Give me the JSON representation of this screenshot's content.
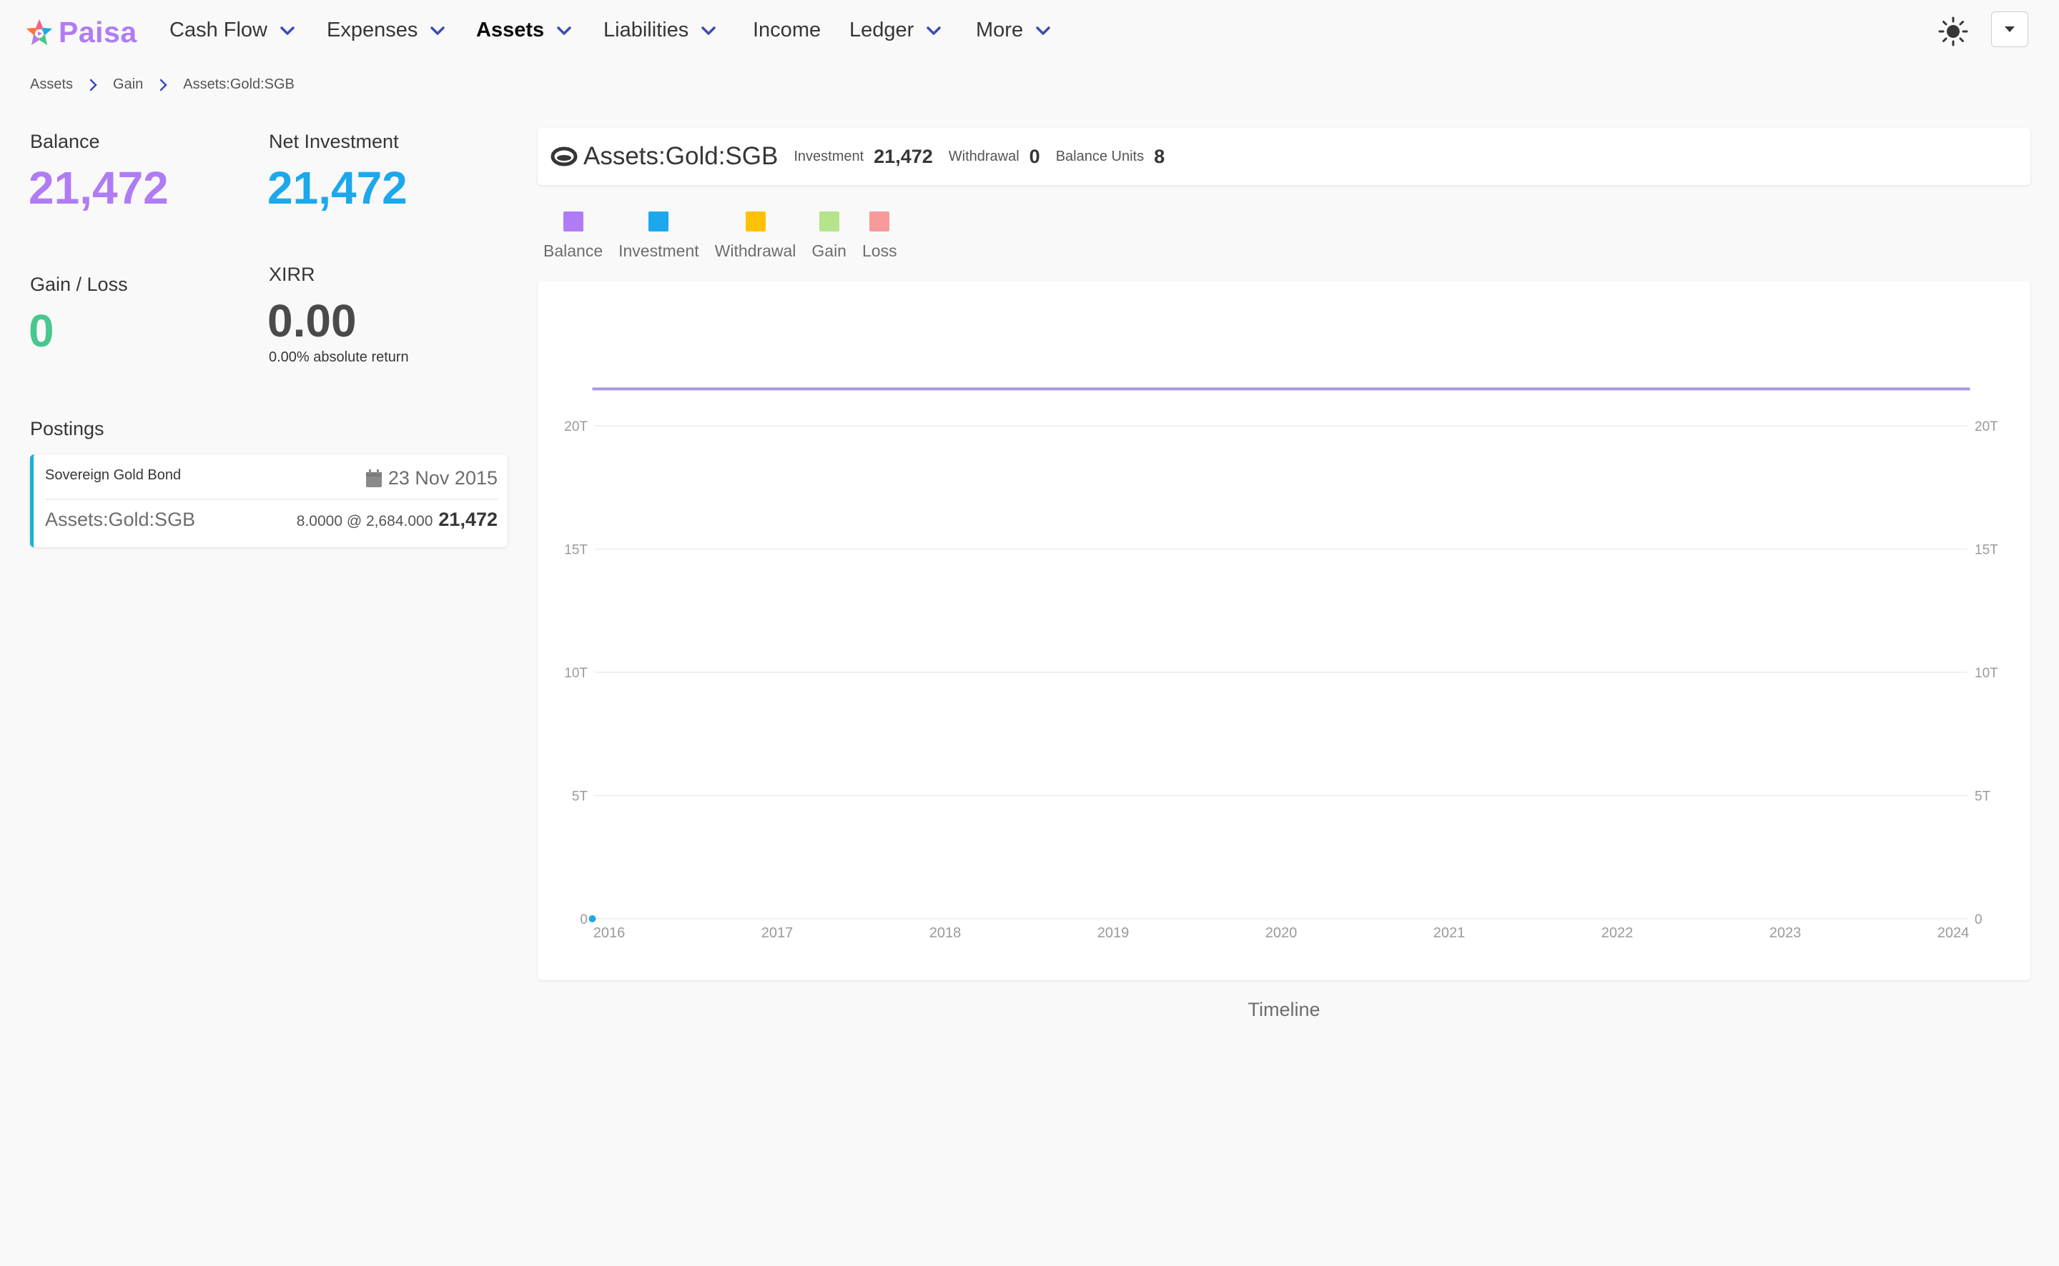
{
  "app": {
    "name": "Paisa"
  },
  "nav": {
    "items": [
      {
        "label": "Cash Flow",
        "has_dropdown": true,
        "active": false
      },
      {
        "label": "Expenses",
        "has_dropdown": true,
        "active": false
      },
      {
        "label": "Assets",
        "has_dropdown": true,
        "active": true
      },
      {
        "label": "Liabilities",
        "has_dropdown": true,
        "active": false
      },
      {
        "label": "Income",
        "has_dropdown": false,
        "active": false
      },
      {
        "label": "Ledger",
        "has_dropdown": true,
        "active": false
      },
      {
        "label": "More",
        "has_dropdown": true,
        "active": false
      }
    ],
    "theme_icon": "sun-icon",
    "user_menu_icon": "caret-down-icon"
  },
  "breadcrumb": [
    "Assets",
    "Gain",
    "Assets:Gold:SGB"
  ],
  "stats": {
    "balance": {
      "label": "Balance",
      "value": "21,472",
      "color": "#b07cf5"
    },
    "net_investment": {
      "label": "Net Investment",
      "value": "21,472",
      "color": "#1ca8ec"
    },
    "gain_loss": {
      "label": "Gain / Loss",
      "value": "0",
      "color": "#48c78e"
    },
    "xirr": {
      "label": "XIRR",
      "value": "0.00",
      "sub": "0.00% absolute return",
      "color": "#4a4a4a"
    }
  },
  "postings": {
    "title": "Postings",
    "items": [
      {
        "description": "Sovereign Gold Bond",
        "date": "23 Nov 2015",
        "account": "Assets:Gold:SGB",
        "quantity": "8.0000 @ 2,684.000",
        "amount": "21,472"
      }
    ]
  },
  "summary": {
    "account": "Assets:Gold:SGB",
    "investment_label": "Investment",
    "investment": "21,472",
    "withdrawal_label": "Withdrawal",
    "withdrawal": "0",
    "balance_units_label": "Balance Units",
    "balance_units": "8"
  },
  "legend": [
    {
      "label": "Balance",
      "color": "#b07cf5"
    },
    {
      "label": "Investment",
      "color": "#1ca8ec"
    },
    {
      "label": "Withdrawal",
      "color": "#ffc107"
    },
    {
      "label": "Gain",
      "color": "#b5e48c"
    },
    {
      "label": "Loss",
      "color": "#f79a9a"
    }
  ],
  "chart_data": {
    "type": "line",
    "xlabel": "Timeline",
    "ylabel": "",
    "x_ticks": [
      "2016",
      "2017",
      "2018",
      "2019",
      "2020",
      "2021",
      "2022",
      "2023",
      "2024"
    ],
    "y_ticks": [
      "0",
      "5T",
      "10T",
      "15T",
      "20T"
    ],
    "y_ticks_right": [
      "0",
      "5T",
      "10T",
      "15T",
      "20T"
    ],
    "ylim": [
      0,
      20
    ],
    "grid": true,
    "series": [
      {
        "name": "Balance",
        "color": "#a996e6",
        "x": [
          2015.9,
          2024.1
        ],
        "values": [
          21.5,
          21.5
        ]
      },
      {
        "name": "Investment",
        "color": "#1ca8ec",
        "x": [
          2015.9
        ],
        "values": [
          0
        ]
      }
    ]
  }
}
